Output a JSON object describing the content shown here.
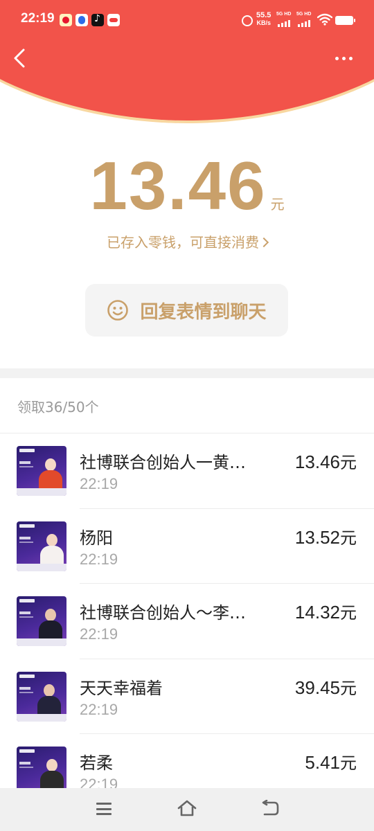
{
  "status_bar": {
    "time": "22:19",
    "net_speed_value": "55.5",
    "net_speed_unit": "KB/s",
    "sim1_label": "5G HD",
    "sim2_label": "5G HD",
    "icons": [
      "weibo-icon",
      "baidu-icon",
      "tiktok-icon",
      "tencent-video-icon",
      "alarm-icon",
      "signal-icon",
      "wifi-icon",
      "battery-icon"
    ]
  },
  "colors": {
    "header_red": "#f2534a",
    "gold": "#c9a06a",
    "rim_yellow": "#f8d7a0"
  },
  "amount": {
    "value": "13.46",
    "unit": "元",
    "stored_text": "已存入零钱，可直接消费"
  },
  "reply_button": {
    "label": "回复表情到聊天"
  },
  "claimed": {
    "label": "领取36/50个"
  },
  "records": [
    {
      "name": "社博联合创始人一黄婷婷",
      "display_name": "社博联合创始人一黄…",
      "time": "22:19",
      "amount": "13.46",
      "unit": "元"
    },
    {
      "name": "杨阳",
      "display_name": "杨阳",
      "time": "22:19",
      "amount": "13.52",
      "unit": "元"
    },
    {
      "name": "社博联合创始人～李…",
      "display_name": "社博联合创始人～李…",
      "time": "22:19",
      "amount": "14.32",
      "unit": "元"
    },
    {
      "name": "天天幸福着",
      "display_name": "天天幸福着",
      "time": "22:19",
      "amount": "39.45",
      "unit": "元"
    },
    {
      "name": "若柔",
      "display_name": "若柔",
      "time": "22:19",
      "amount": "5.41",
      "unit": "元"
    }
  ]
}
